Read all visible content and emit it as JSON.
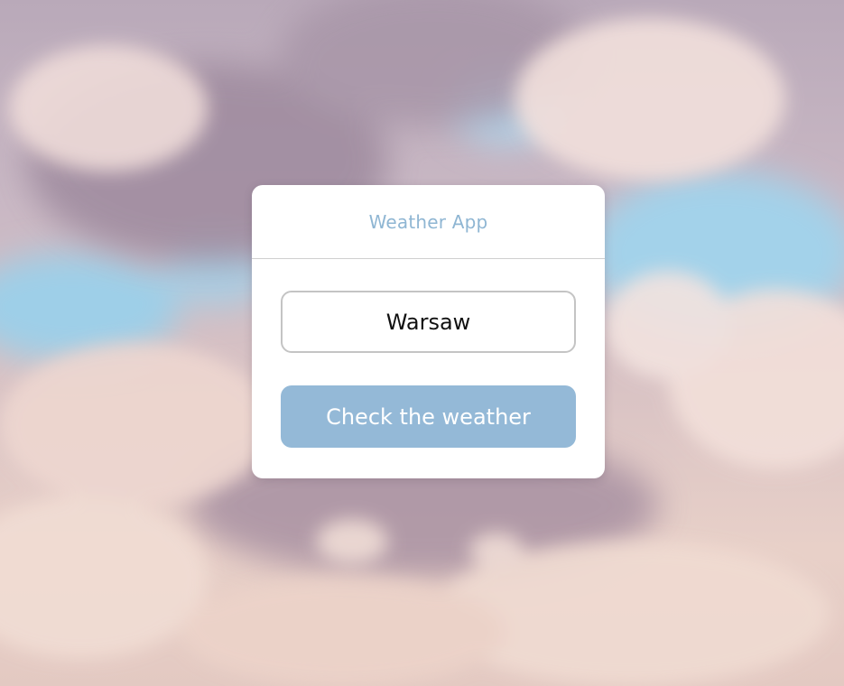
{
  "app": {
    "title": "Weather App"
  },
  "form": {
    "city_value": "Warsaw",
    "submit_label": "Check the weather"
  },
  "colors": {
    "accent": "#94b9d7",
    "title": "#8fb6d3",
    "card": "#ffffff",
    "input_border": "#c4c4c4"
  },
  "background": {
    "description_icon": "cloudy-sky-background"
  }
}
